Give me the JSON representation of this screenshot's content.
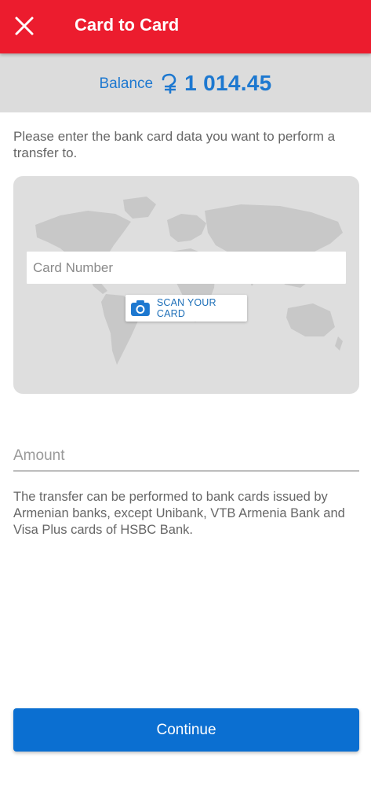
{
  "header": {
    "title": "Card to Card",
    "close_icon": "close-icon",
    "background_color": "#ec1c2e"
  },
  "balance": {
    "label": "Balance",
    "currency_icon": "armenian-dram-icon",
    "amount": "1 014.45",
    "color": "#1d78d0"
  },
  "intro_text": "Please enter the bank card data you want to perform a transfer to.",
  "card": {
    "number_placeholder": "Card Number",
    "number_value": "",
    "scan_icon": "camera-icon",
    "scan_label": "SCAN YOUR CARD"
  },
  "amount": {
    "placeholder": "Amount",
    "value": ""
  },
  "note_text": "The transfer can be performed to bank cards issued by Armenian banks, except Unibank, VTB Armenia Bank and Visa Plus cards of HSBC Bank.",
  "continue": {
    "label": "Continue",
    "color": "#0b6fd1"
  }
}
